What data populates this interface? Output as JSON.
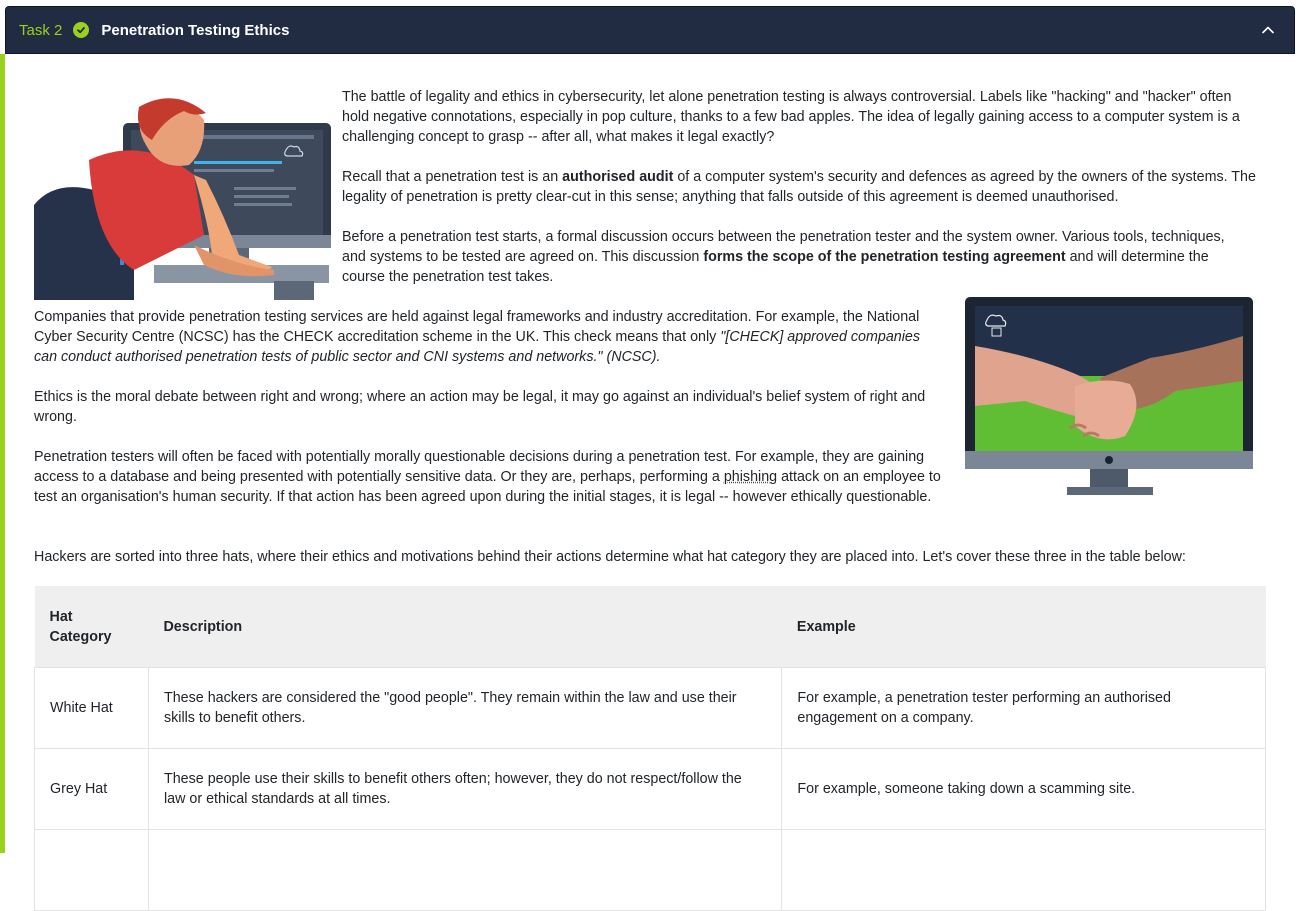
{
  "task": {
    "number": "Task 2",
    "title": "Penetration Testing Ethics"
  },
  "content": {
    "p1": "The battle of legality and ethics in cybersecurity, let alone penetration testing is always controversial. Labels like \"hacking\" and \"hacker\" often hold negative connotations, especially in pop culture, thanks to a few bad apples. The idea of legally gaining access to a computer system is a challenging concept to grasp -- after all, what makes it legal exactly?",
    "p2_a": "Recall that a penetration test is an ",
    "p2_b": "authorised audit",
    "p2_c": " of a computer system's security and defences as agreed by the owners of the systems. The legality of penetration is pretty clear-cut in this sense; anything that falls outside of this agreement is deemed unauthorised.",
    "p3_a": "Before a penetration test starts, a formal discussion occurs between the penetration tester and the system owner. Various tools, techniques, and systems to be tested are agreed on. This discussion ",
    "p3_b": "forms the scope of the penetration testing agreement",
    "p3_c": " and will determine the course the penetration test takes.",
    "p4_a": "Companies that provide penetration testing services are held against legal frameworks and industry accreditation. For example, the National Cyber Security Centre (NCSC) has the CHECK accreditation scheme in the UK. This check means that only ",
    "p4_b": "\"[CHECK] approved companies can conduct authorised penetration tests of public sector and CNI systems and networks.\" (NCSC).",
    "p5": "Ethics is the moral debate between right and wrong; where an action may be legal, it may go against an individual's belief system of right and wrong.",
    "p6_a": "Penetration testers will often be faced with potentially morally questionable decisions during a penetration test. For example, they are gaining access to a database and being presented with potentially sensitive data. Or they are, perhaps, performing a ",
    "p6_link": "phishing",
    "p6_b": " attack on an employee to test an organisation's human security. If that action has been agreed upon during the initial stages, it is legal -- however ethically questionable.",
    "p7": "Hackers are sorted into three hats, where their ethics and motivations behind their actions determine what hat category they are placed into. Let's cover these three in the table below:"
  },
  "table": {
    "headers": [
      "Hat Category",
      "Description",
      "Example"
    ],
    "rows": [
      [
        "White Hat",
        "These hackers are considered the \"good people\". They remain within the law and use their skills to benefit others.",
        "For example, a penetration tester performing an authorised engagement on a company."
      ],
      [
        "Grey Hat",
        "These people use their skills to benefit others often; however, they do not respect/follow the law or ethical standards at all times.",
        "For example, someone taking down a scamming site."
      ]
    ]
  },
  "colors": {
    "header_bg": "#212c42",
    "accent": "#9ad11c"
  },
  "icons": [
    "check-circle-icon",
    "chevron-up-icon"
  ]
}
